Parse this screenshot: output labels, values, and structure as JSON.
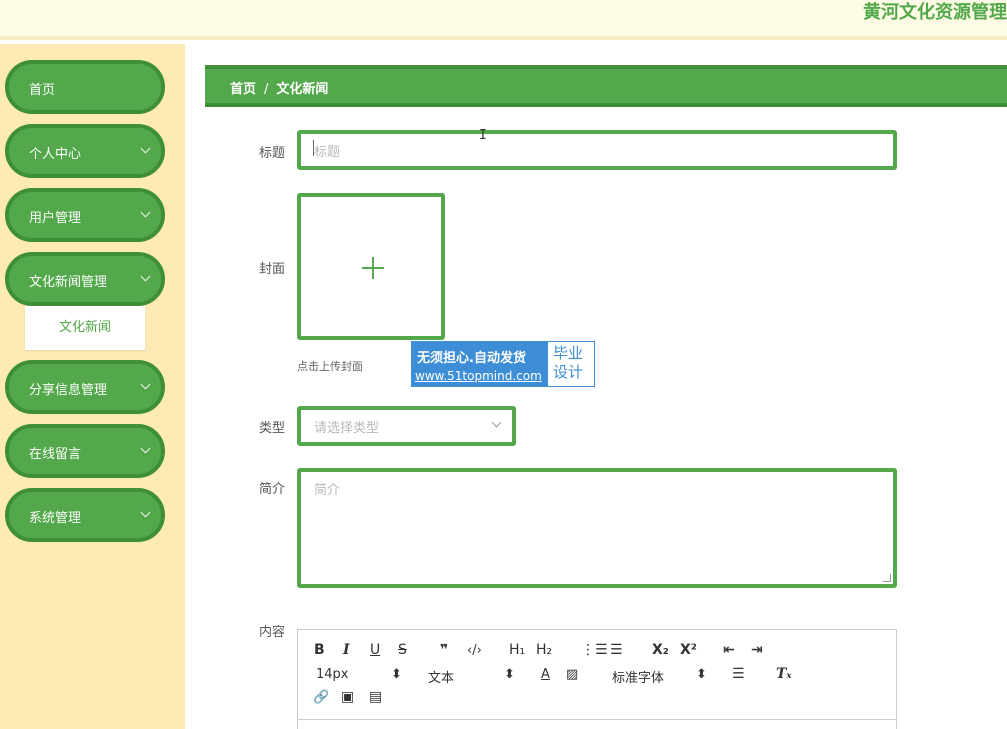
{
  "header": {
    "site_title": "黄河文化资源管理"
  },
  "sidebar": {
    "items": [
      {
        "label": "首页",
        "has_arrow": false
      },
      {
        "label": "个人中心",
        "has_arrow": true
      },
      {
        "label": "用户管理",
        "has_arrow": true
      },
      {
        "label": "文化新闻管理",
        "has_arrow": true
      },
      {
        "label": "分享信息管理",
        "has_arrow": true
      },
      {
        "label": "在线留言",
        "has_arrow": true
      },
      {
        "label": "系统管理",
        "has_arrow": true
      }
    ],
    "sub_item": "文化新闻"
  },
  "breadcrumb": {
    "home": "首页",
    "separator": "/",
    "current": "文化新闻"
  },
  "form": {
    "title_label": "标题",
    "title_placeholder": "标题",
    "cover_label": "封面",
    "cover_hint": "点击上传封面",
    "type_label": "类型",
    "type_placeholder": "请选择类型",
    "intro_label": "简介",
    "intro_placeholder": "简介",
    "content_label": "内容"
  },
  "watermark": {
    "line1": "无须担心.自动发货",
    "line2": "www.51topmind.com",
    "right_line1": "毕业",
    "right_line2": "设计"
  },
  "editor": {
    "bold": "B",
    "italic": "I",
    "underline": "U",
    "strike": "S",
    "quote": "❞",
    "code": "‹/›",
    "h1": "H₁",
    "h2": "H₂",
    "ordered_list": "⋮☰",
    "bullet_list": "☰",
    "subscript": "X₂",
    "superscript": "X²",
    "outdent": "⇤",
    "indent": "⇥",
    "font_size": "14px",
    "text_style": "文本",
    "font_color": "A",
    "background": "▨",
    "font_family": "标准字体",
    "align": "☰",
    "clean": "Tₓ",
    "link": "🔗",
    "image": "▣",
    "video": "▤",
    "select_arrow": "⬍"
  },
  "colors": {
    "primary": "#52a84a",
    "primary_dark": "#3f8f39",
    "sidebar_bg": "#feeab5",
    "header_bg": "#fdfbe6"
  }
}
